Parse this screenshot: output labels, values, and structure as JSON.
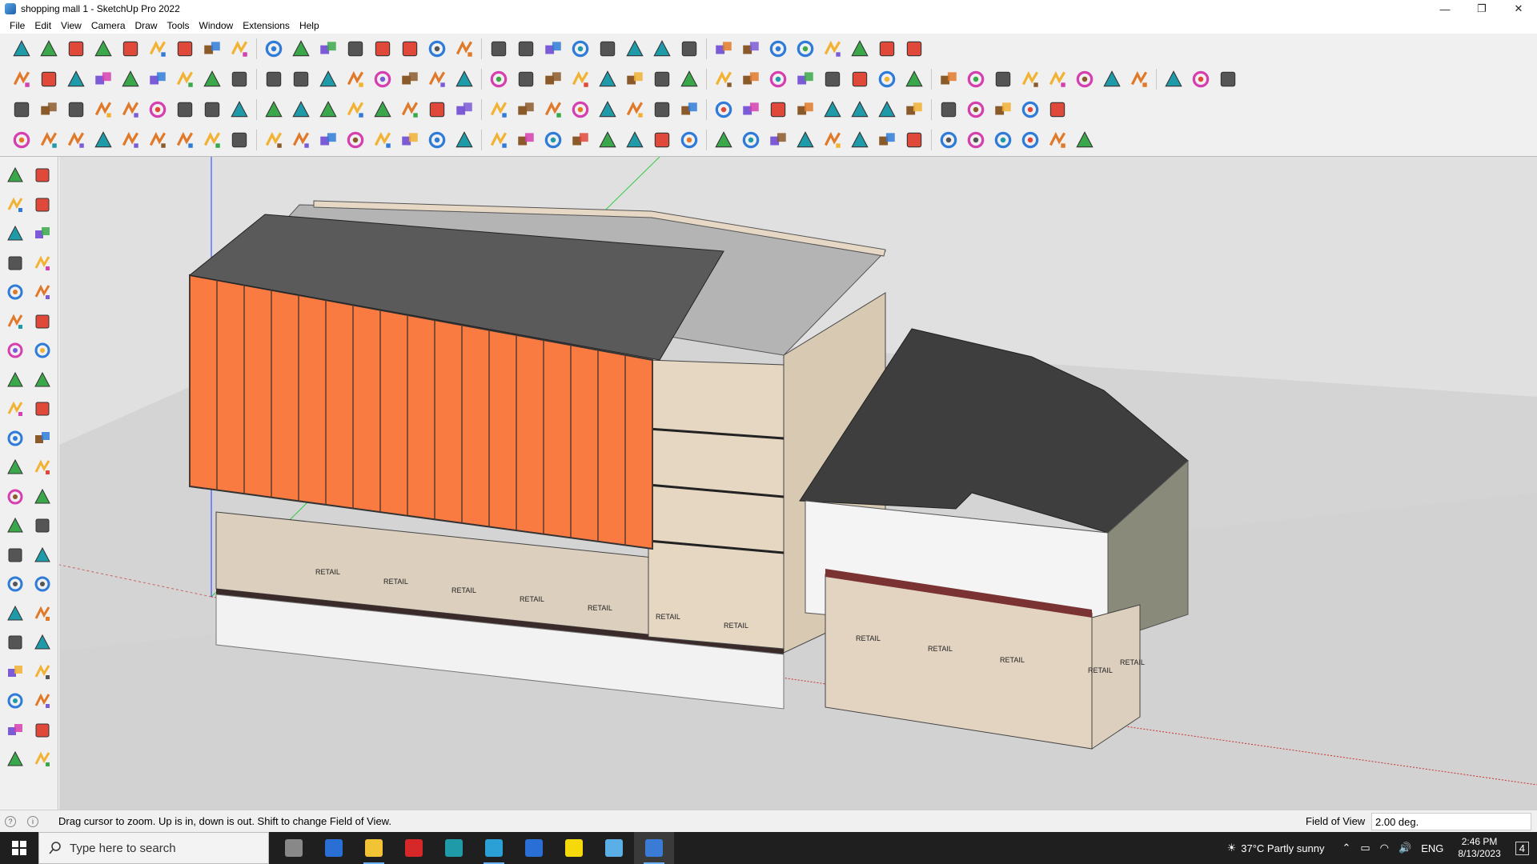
{
  "window": {
    "title": "shopping mall 1 - SketchUp Pro 2022",
    "minimize_glyph": "—",
    "restore_glyph": "❐",
    "close_glyph": "✕"
  },
  "menu": [
    "File",
    "Edit",
    "View",
    "Camera",
    "Draw",
    "Tools",
    "Window",
    "Extensions",
    "Help"
  ],
  "toolbars": {
    "row1": [
      "zoom-icon",
      "select-icon",
      "eraser-icon",
      "pencil-line-icon",
      "lasso-icon",
      "paint-bucket-icon",
      "push-pull-icon",
      "follow-me-icon",
      "move-icon",
      "rotate-icon",
      "scale-icon",
      "tape-measure-icon",
      "text-icon",
      "paint-icon",
      "orbit-icon",
      "pan-icon",
      "zoom-window-icon",
      "zoom-extents-icon",
      "iso-view-icon",
      "top-view-icon",
      "front-view-icon",
      "section-icon",
      "profile-icon",
      "component-icon",
      "group-icon",
      "axis-icon",
      "arrows-updown-icon",
      "arrows-sort-icon",
      "scale-tool-icon",
      "flip-icon",
      "undo-icon",
      "redo-icon",
      "wand-icon"
    ],
    "row2": [
      "box-yellow-icon",
      "box-blue-icon",
      "box-multi-icon",
      "push-down-icon",
      "push-up-icon",
      "arrow-red-icon",
      "arrow-green-icon",
      "arrow-orange-icon",
      "arrow-magenta-icon",
      "curve-icon",
      "stripes-blue-icon",
      "stripes-orange-icon",
      "stripes-red-icon",
      "diamond-green-icon",
      "star-green-icon",
      "house-1-icon",
      "house-2-icon",
      "house-3-icon",
      "house-4-icon",
      "house-5-icon",
      "house-6-icon",
      "text-3d-icon",
      "leaf-icon",
      "pen-red-icon",
      "circle-1-icon",
      "circle-2-icon",
      "circle-3-icon",
      "ellipse-icon",
      "ellipse-2-icon",
      "parallelogram-icon",
      "arc-1-icon",
      "arc-2-icon",
      "arc-3-icon",
      "shape-blue-icon",
      "shape-2-icon",
      "knife-icon",
      "eraser-pink-icon",
      "brick-icon",
      "grid-red-icon",
      "terrain-icon",
      "terrain-2-icon",
      "terrain-3-icon",
      "terrain-4-icon",
      "terrain-5-icon"
    ],
    "row3": [
      "panel-blue-icon",
      "panel-blue-2-icon",
      "panel-yellow-icon",
      "panel-green-icon",
      "panel-red-icon",
      "panel-gray-icon",
      "spiral-icon",
      "square-red-icon",
      "frame-icon",
      "door-icon",
      "stair-icon",
      "railing-icon",
      "bend-icon",
      "dots-icon",
      "cross-red-icon",
      "cross-green-icon",
      "cross-blue-icon",
      "cone-icon",
      "fountain-icon",
      "triangle-icon",
      "loop-icon",
      "loop-2-icon",
      "loop-3-icon",
      "star-blue-icon",
      "box-brown-icon",
      "hook-red-icon",
      "chain-green-icon",
      "network-icon",
      "molecule-icon",
      "bolt-icon",
      "gem-icon",
      "flower-icon",
      "table-icon",
      "grid-orange-icon",
      "grid-orange-2-icon",
      "scatter-icon",
      "arc-dots-icon",
      "tree-icon"
    ],
    "row4": [
      "edit-path-icon",
      "dotted-curve-icon",
      "car-red-icon",
      "scissors-icon",
      "gear-outline-icon",
      "sketch-icon",
      "pipe-icon",
      "hull-icon",
      "spider-icon",
      "twist-icon",
      "stair-line-icon",
      "stair-line-2-icon",
      "measure-red-icon",
      "curve-red-icon",
      "box-3d-icon",
      "slope-icon",
      "comb-icon",
      "wave-icon",
      "shell-icon",
      "leaf-outline-icon",
      "fork-icon",
      "stack-icon",
      "rake-icon",
      "rake-2-icon",
      "rake-3-icon",
      "rake-4-icon",
      "stamp-icon",
      "stripe-black-icon",
      "book-icon",
      "bricks-icon",
      "fence-icon",
      "grid-black-icon",
      "stack-lines-icon",
      "columns-icon",
      "web-icon",
      "web-2-icon",
      "streaks-icon",
      "streaks-2-icon",
      "outline-icon"
    ]
  },
  "left_tray": [
    "select-icon",
    "orbit-icon",
    "paint-bucket-icon",
    "eraser-icon",
    "component-icon",
    "tape-measure-icon",
    "pencil-icon",
    "freehand-icon",
    "rectangle-icon",
    "rotated-rect-icon",
    "circle-icon",
    "polygon-icon",
    "arc-icon",
    "arc-2-icon",
    "pie-icon",
    "arc-3-icon",
    "move-icon",
    "push-pull-icon",
    "rotate-icon",
    "follow-me-icon",
    "scale-icon",
    "offset-icon",
    "tape-icon",
    "dimension-icon",
    "protractor-icon",
    "text-icon",
    "axes-icon",
    "3d-text-icon",
    "orbit-2-icon",
    "pan-icon",
    "zoom-icon",
    "zoom-window-icon",
    "zoom-extents-icon",
    "previous-view-icon",
    "position-camera-icon",
    "look-around-icon",
    "walk-icon",
    "section-plane-icon",
    "iso-icon",
    "section-2-icon",
    "stack-icon",
    "stack-2-icon"
  ],
  "status": {
    "hint": "Drag cursor to zoom.  Up is in, down is out. Shift to change Field of View.",
    "fov_label": "Field of View",
    "fov_value": "2.00 deg."
  },
  "viewport": {
    "building_labels": [
      "RETAIL",
      "RETAIL",
      "RETAIL",
      "RETAIL",
      "RETAIL",
      "RETAIL",
      "RETAIL",
      "RETAIL",
      "RETAIL",
      "RETAIL",
      "RETAIL",
      "RETAIL"
    ],
    "colors": {
      "background": "#e0e0e0",
      "ground": "#d4d4d4",
      "facade_orange": "#f97b42",
      "roof_dark": "#4a4a4a",
      "wall_beige": "#dccfbd",
      "axis_red": "#c83232",
      "axis_green": "#2ecc40",
      "axis_blue": "#1e3cff"
    }
  },
  "taskbar": {
    "search_placeholder": "Type here to search",
    "apps": [
      "task-view-icon",
      "calculator-icon",
      "file-explorer-icon",
      "acrobat-icon",
      "app-icon",
      "edge-icon",
      "photos-icon",
      "sticky-notes-icon",
      "pdf-icon",
      "sketchup-icon"
    ],
    "weather": "37°C  Partly sunny",
    "language": "ENG",
    "time": "2:46 PM",
    "date": "8/13/2023",
    "notifications": "4"
  }
}
